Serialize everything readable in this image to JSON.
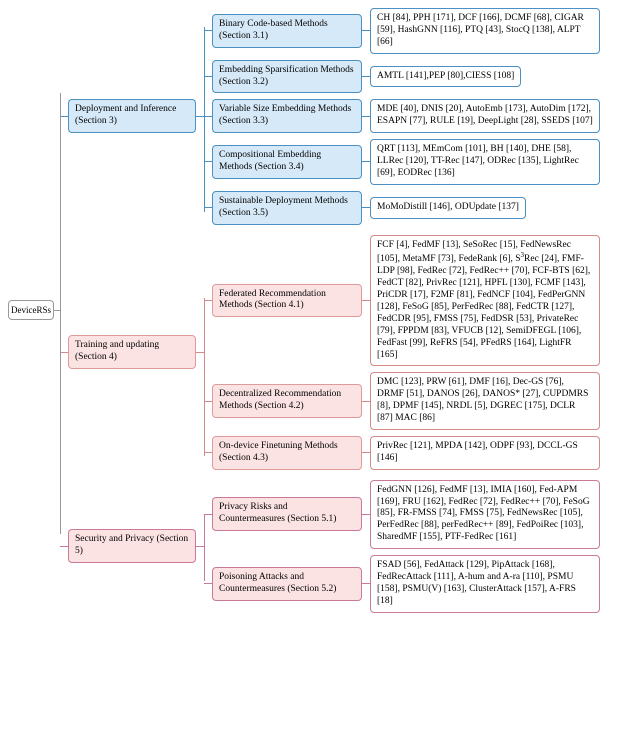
{
  "root": "DeviceRSs",
  "sections": [
    {
      "label": "Deployment and Inference (Section 3)",
      "color": "blue",
      "children": [
        {
          "label": "Binary Code-based Methods (Section 3.1)",
          "leaf": "CH [84], PPH [171], DCF [166], DCMF [68], CIGAR [59], HashGNN [116], PTQ [43], StocQ [138], ALPT [66]"
        },
        {
          "label": "Embedding Sparsification Methods (Section 3.2)",
          "leaf": "AMTL [141],PEP [80],CIESS [108]"
        },
        {
          "label": "Variable Size Embedding Methods (Section 3.3)",
          "leaf": "MDE [40], DNIS [20], AutoEmb [173], AutoDim [172], ESAPN [77], RULE [19], DeepLight [28], SSEDS [107]"
        },
        {
          "label": "Compositional Embedding Methods (Section 3.4)",
          "leaf": "QRT [113], MEmCom [101], BH [140], DHE [58], LLRec [120], TT-Rec [147], ODRec [135], LightRec [69], EODRec [136]"
        },
        {
          "label": "Sustainable Deployment Methods (Section 3.5)",
          "leaf": "MoMoDistill [146], ODUpdate [137]"
        }
      ]
    },
    {
      "label": "Training and updating (Section 4)",
      "color": "pink-a",
      "children": [
        {
          "label": "Federated Recommendation Methods (Section 4.1)",
          "leaf": "FCF [4], FedMF [13], SeSoRec [15], FedNewsRec [105], MetaMF [73], FedeRank [6], S³Rec [24], FMF-LDP [98], FedRec [72], FedRec++ [70], FCF-BTS [62], FedCT [82], PrivRec [121], HPFL [130], FCMF [143], PriCDR [17], F2MF [81], FedNCF [104], FedPerGNN [128], FeSoG [85], PerFedRec [88], FedCTR [127], FedCDR [95], FMSS [75], FedDSR [53], PrivateRec [79], FPPDM [83], VFUCB [12], SemiDFEGL [106], FedFast [99], ReFRS [54], PFedRS [164], LightFR [165]"
        },
        {
          "label": "Decentralized Recommendation Methods (Section 4.2)",
          "leaf": "DMC [123], PRW [61], DMF [16], Dec-GS [76], DRMF [51], DANOS [26], DANOS* [27], CUPDMRS [8], DPMF [145], NRDL [5], DGREC [175], DCLR [87] MAC [86]"
        },
        {
          "label": "On-device Finetuning Methods (Section 4.3)",
          "leaf": "PrivRec [121], MPDA [142], ODPF [93], DCCL-GS [146]"
        }
      ]
    },
    {
      "label": "Security and Privacy (Section 5)",
      "color": "pink-b",
      "children": [
        {
          "label": "Privacy Risks and Countermeasures (Section 5.1)",
          "leaf": "FedGNN [126], FedMF [13], IMIA [160], Fed-APM [169], FRU [162], FedRec [72], FedRec++ [70], FeSoG [85], FR-FMSS [74], FMSS [75], FedNewsRec [105], PerFedRec [88], perFedRec++ [89], FedPoiRec [103], SharedMF [155], PTF-FedRec [161]"
        },
        {
          "label": "Poisoning Attacks and Countermeasures (Section 5.2)",
          "leaf": "FSAD [56], FedAttack [129], PipAttack [168], FedRecAttack [111], A-hum and A-ra [110], PSMU [158], PSMU(V) [163], ClusterAttack [157], A-FRS [18]"
        }
      ]
    }
  ]
}
